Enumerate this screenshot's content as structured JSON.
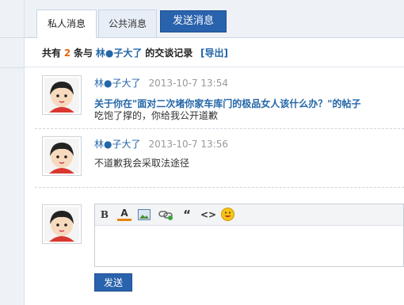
{
  "tabs": [
    {
      "label": "私人消息"
    },
    {
      "label": "公共消息"
    }
  ],
  "send_tab_label": "发送消息",
  "summary": {
    "prefix": "共有",
    "count": "2",
    "mid": "条与",
    "contact": "林●子大了",
    "suffix": "的交谈记录",
    "export": "[导出]"
  },
  "messages": [
    {
      "name": "林●子大了",
      "time": "2013-10-7 13:54",
      "title": "关于你在\"面对二次堵你家车库门的极品女人该什么办？\"的帖子",
      "body": "吃饱了撑的，你给我公开道歉"
    },
    {
      "name": "林●子大了",
      "time": "2013-10-7 13:56",
      "body": "不道歉我会采取法途径"
    }
  ],
  "editor": {
    "toolbar": [
      {
        "icon": "bold-icon",
        "glyph": "B"
      },
      {
        "icon": "font-color-icon",
        "glyph": "A"
      },
      {
        "icon": "image-icon",
        "glyph": ""
      },
      {
        "icon": "link-icon",
        "glyph": ""
      },
      {
        "icon": "quote-icon",
        "glyph": "“"
      },
      {
        "icon": "code-icon",
        "glyph": "<>"
      },
      {
        "icon": "emoji-icon",
        "glyph": ""
      }
    ]
  },
  "send_button": "发送",
  "colors": {
    "accent": "#2a63ad",
    "link": "#2366a8",
    "count": "#e6650e"
  }
}
